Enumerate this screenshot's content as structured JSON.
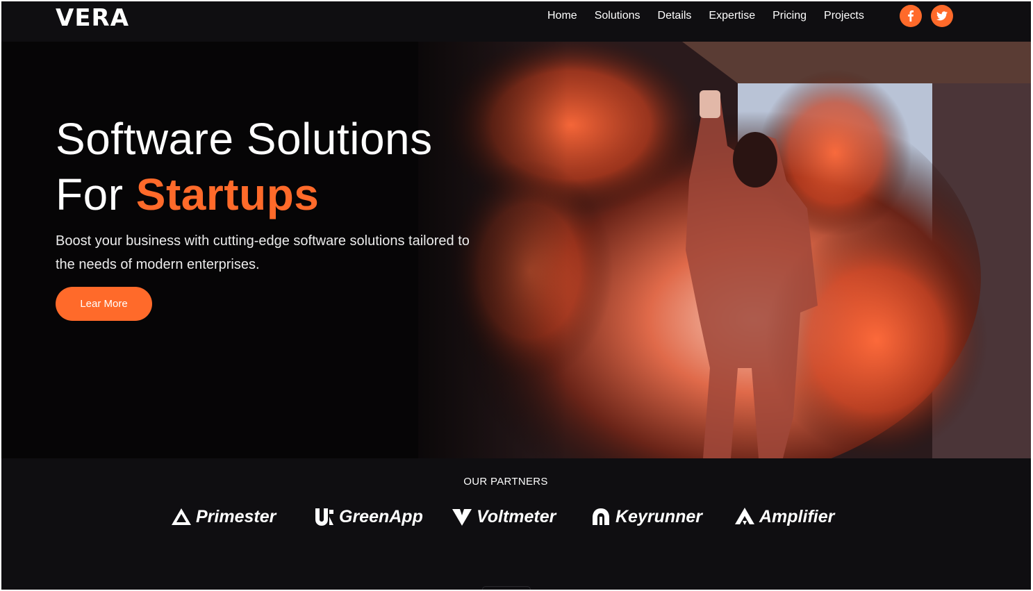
{
  "nav": {
    "logo": "VERA",
    "items": [
      "Home",
      "Solutions",
      "Details",
      "Expertise",
      "Pricing",
      "Projects"
    ],
    "social": [
      "facebook-icon",
      "twitter-icon"
    ]
  },
  "hero": {
    "headline_line1": "Software Solutions",
    "headline_for": "For",
    "headline_accent": "Startups",
    "subtext": "Boost your business with cutting-edge software solutions tailored to the needs of modern enterprises.",
    "cta_label": "Lear More"
  },
  "partners": {
    "title": "OUR PARTNERS",
    "items": [
      "Primester",
      "GreenApp",
      "Voltmeter",
      "Keyrunner",
      "Amplifier"
    ]
  },
  "colors": {
    "accent": "#ff6a2a",
    "background": "#0f0e11",
    "text": "#ffffff"
  }
}
